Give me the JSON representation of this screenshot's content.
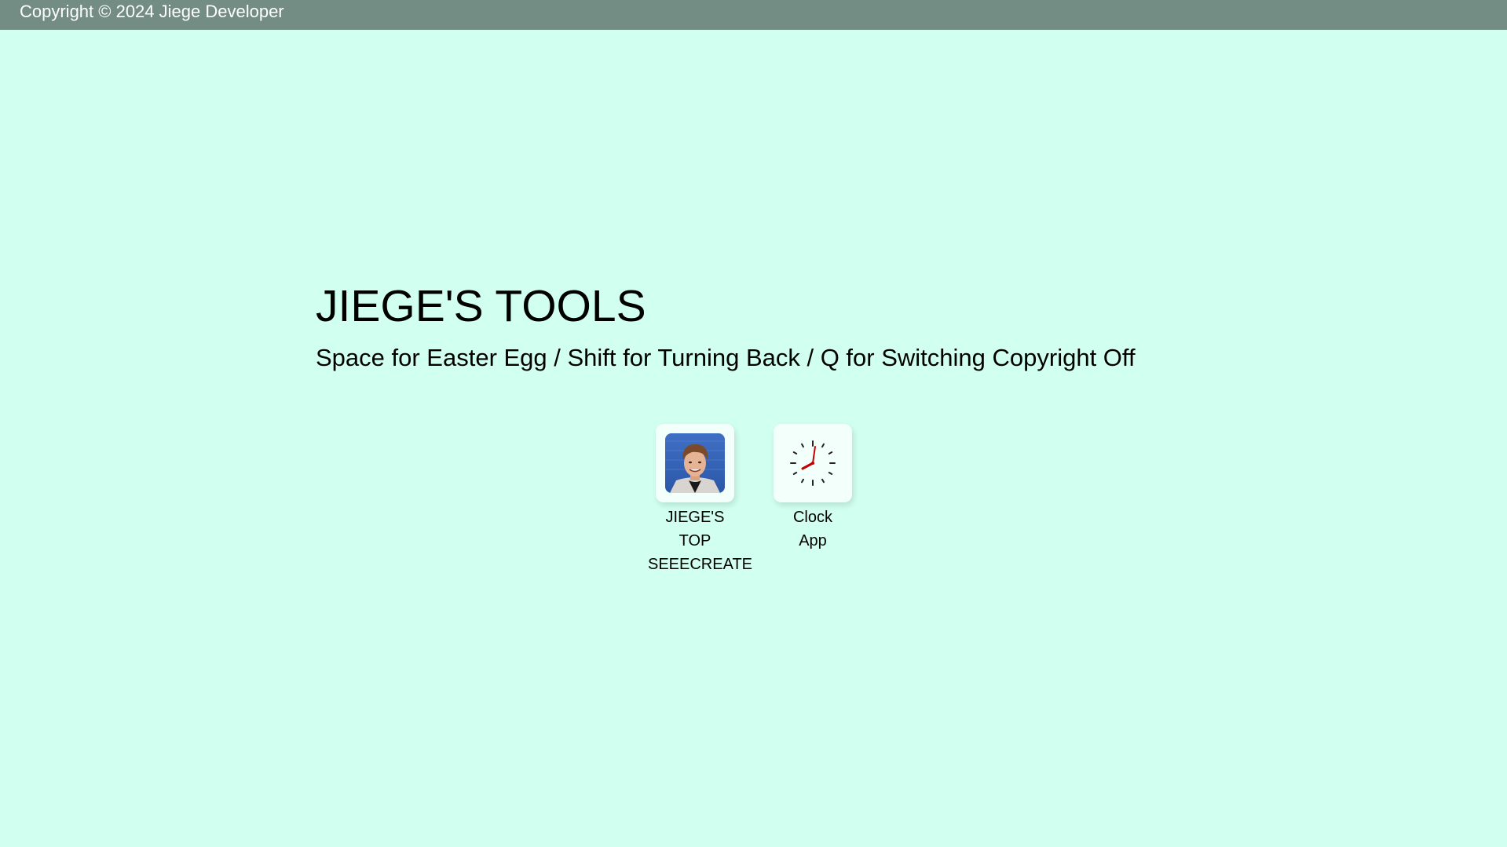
{
  "header": {
    "copyright": "Copyright © 2024 Jiege Developer"
  },
  "main": {
    "title": "JIEGE'S TOOLS",
    "subtitle": "Space for Easter Egg / Shift for Turning Back / Q for Switching Copyright Off"
  },
  "apps": [
    {
      "label": "JIEGE'S TOP SEEECREATE",
      "icon": "person-photo-icon"
    },
    {
      "label": "Clock App",
      "icon": "clock-icon"
    }
  ],
  "colors": {
    "background": "#d1fff0",
    "topbar": "#738c84",
    "tile": "#f2fffa",
    "clock_hand": "#cc0000"
  }
}
